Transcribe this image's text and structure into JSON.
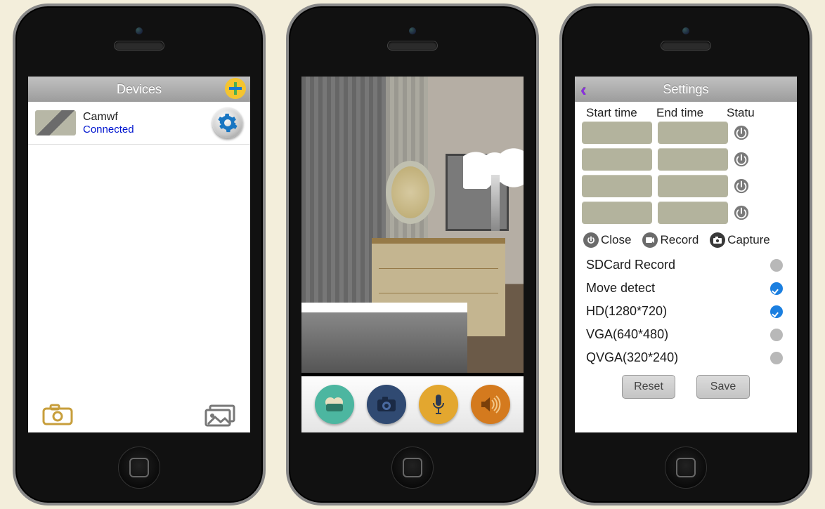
{
  "phone1": {
    "title": "Devices",
    "device": {
      "name": "Camwf",
      "status": "Connected"
    }
  },
  "phone3": {
    "title": "Settings",
    "cols": {
      "start": "Start time",
      "end": "End time",
      "status": "Statu"
    },
    "actions": {
      "close": "Close",
      "record": "Record",
      "capture": "Capture"
    },
    "options": {
      "sdcard": {
        "label": "SDCard Record",
        "checked": false
      },
      "movedetect": {
        "label": "Move detect",
        "checked": true
      },
      "hd": {
        "label": "HD(1280*720)",
        "checked": true
      },
      "vga": {
        "label": "VGA(640*480)",
        "checked": false
      },
      "qvga": {
        "label": "QVGA(320*240)",
        "checked": false
      }
    },
    "buttons": {
      "reset": "Reset",
      "save": "Save"
    }
  }
}
